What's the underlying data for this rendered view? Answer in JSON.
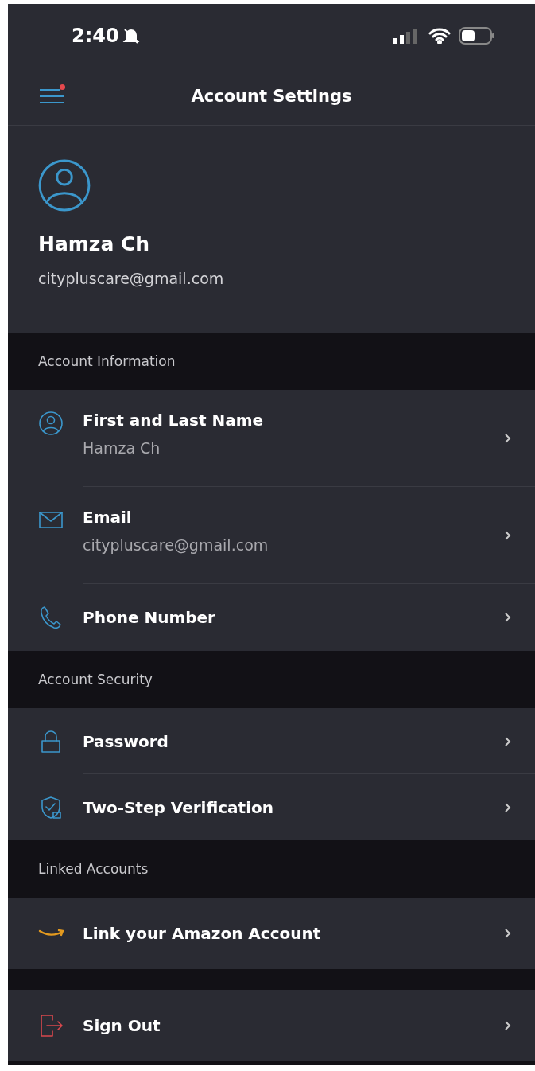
{
  "status_bar": {
    "time": "2:40",
    "silent": true
  },
  "header": {
    "title": "Account Settings",
    "menu_notification": true
  },
  "profile": {
    "name": "Hamza Ch",
    "email": "citypluscare@gmail.com"
  },
  "sections": [
    {
      "title": "Account Information",
      "items": [
        {
          "kind": "person",
          "label": "First and Last Name",
          "value": "Hamza Ch"
        },
        {
          "kind": "mail",
          "label": "Email",
          "value": "citypluscare@gmail.com"
        },
        {
          "kind": "phone",
          "label": "Phone Number"
        }
      ]
    },
    {
      "title": "Account Security",
      "items": [
        {
          "kind": "lock",
          "label": "Password"
        },
        {
          "kind": "shield",
          "label": "Two-Step Verification"
        }
      ]
    },
    {
      "title": "Linked Accounts",
      "items": [
        {
          "kind": "amazon",
          "label": "Link your Amazon Account"
        }
      ]
    },
    {
      "items": [
        {
          "kind": "signout",
          "label": "Sign Out"
        }
      ]
    }
  ]
}
